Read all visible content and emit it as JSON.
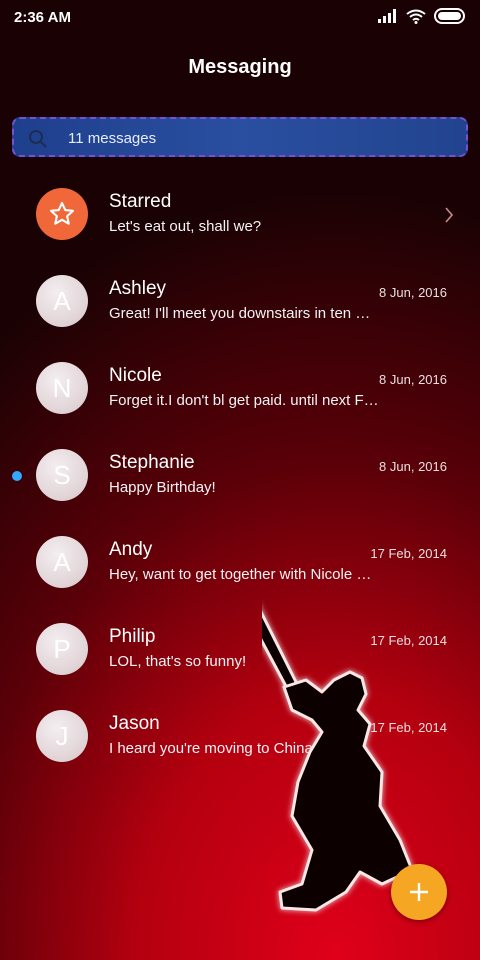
{
  "status_bar": {
    "time": "2:36 AM",
    "icons": [
      "signal-icon",
      "wifi-icon",
      "battery-icon"
    ]
  },
  "header": {
    "title": "Messaging"
  },
  "search": {
    "text": "11 messages",
    "icon": "search-icon"
  },
  "conversations": [
    {
      "name": "Starred",
      "preview": "Let's eat out, shall we?",
      "date": "",
      "avatar": "",
      "icon": "star-icon",
      "unread": false
    },
    {
      "name": "Ashley",
      "preview": "Great! I'll meet you downstairs in ten …",
      "date": "8 Jun, 2016",
      "avatar": "A",
      "unread": false
    },
    {
      "name": "Nicole",
      "preview": "Forget it.I don't bl get paid. until next F…",
      "date": "8 Jun, 2016",
      "avatar": "N",
      "unread": false
    },
    {
      "name": "Stephanie",
      "preview": "Happy Birthday!",
      "date": "8 Jun, 2016",
      "avatar": "S",
      "unread": true
    },
    {
      "name": "Andy",
      "preview": "Hey, want to get together with Nicole …",
      "date": "17 Feb, 2014",
      "avatar": "A",
      "unread": false
    },
    {
      "name": "Philip",
      "preview": "LOL, that's so funny!",
      "date": "17 Feb, 2014",
      "avatar": "P",
      "unread": false
    },
    {
      "name": "Jason",
      "preview": "I heard you're moving to China.",
      "date": "17 Feb, 2014",
      "avatar": "J",
      "unread": false
    }
  ],
  "fab": {
    "icon": "plus-icon"
  },
  "colors": {
    "accent": "#f5a623",
    "starred": "#f0683a",
    "unread": "#35a7ff"
  }
}
